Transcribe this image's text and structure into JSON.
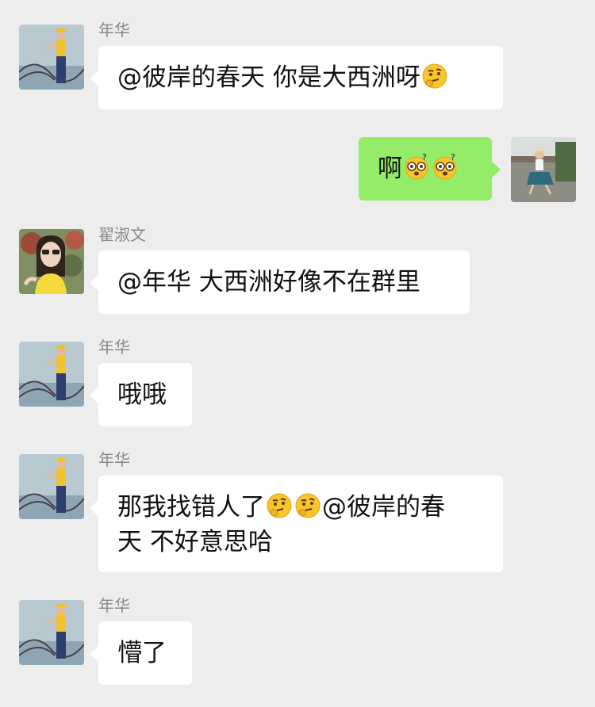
{
  "colors": {
    "background": "#ededed",
    "bubble_in": "#ffffff",
    "bubble_out": "#95ec69",
    "sender_name": "#888888"
  },
  "messages": [
    {
      "sender": "年华",
      "parts": [
        "@彼岸的春天 你是大西洲呀",
        "thinking-face-emoji"
      ],
      "text_1": "@彼岸的春天 你是大西洲呀"
    },
    {
      "sender": "",
      "text_1": "啊",
      "emojis": [
        "dizzy-face-emoji",
        "dizzy-face-emoji"
      ]
    },
    {
      "sender": "翟淑文",
      "text_1": "@年华 大西洲好像不在群里"
    },
    {
      "sender": "年华",
      "text_1": "哦哦"
    },
    {
      "sender": "年华",
      "text_1": "那我找错人了",
      "text_2": "@彼岸的春",
      "text_3": "天 不好意思哈",
      "emojis": [
        "thinking-face-emoji",
        "thinking-face-emoji"
      ]
    },
    {
      "sender": "年华",
      "text_1": "懵了"
    }
  ]
}
